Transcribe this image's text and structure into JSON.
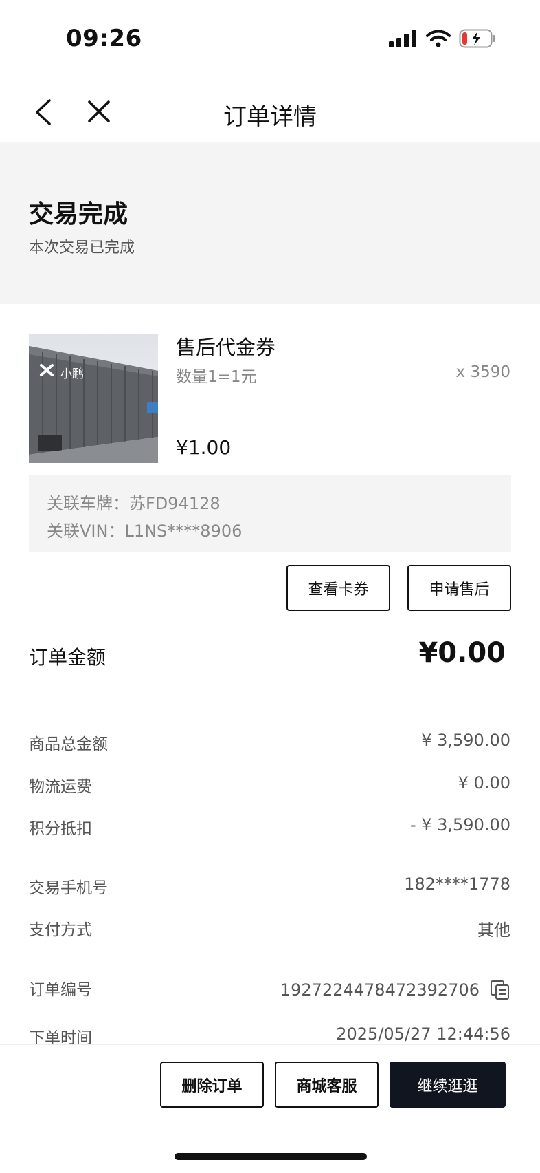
{
  "status_bar": {
    "time": "09:26"
  },
  "nav": {
    "title": "订单详情"
  },
  "order_status": {
    "heading": "交易完成",
    "description": "本次交易已完成"
  },
  "product": {
    "name": "售后代金券",
    "quantity_desc": "数量1=1元",
    "count": "x 3590",
    "price": "¥1.00",
    "thumbnail_logo": "小鹏",
    "plate": "关联车牌：苏FD94128",
    "vin": "关联VIN：L1NS****8906"
  },
  "actions": {
    "view_coupon": "查看卡券",
    "after_sale": "申请售后"
  },
  "order_amount": {
    "label": "订单金额",
    "value": "¥0.00"
  },
  "details": [
    {
      "label": "商品总金额",
      "value": "¥ 3,590.00"
    },
    {
      "label": "物流运费",
      "value": "¥ 0.00"
    },
    {
      "label": "积分抵扣",
      "value": "- ¥ 3,590.00"
    },
    {
      "label": "交易手机号",
      "value": "182****1778"
    },
    {
      "label": "支付方式",
      "value": "其他"
    },
    {
      "label": "订单编号",
      "value": "1927224478472392706"
    },
    {
      "label": "下单时间",
      "value": "2025/05/27 12:44:56"
    }
  ],
  "bottom": {
    "delete": "删除订单",
    "service": "商城客服",
    "continue": "继续逛逛"
  },
  "colors": {
    "primary_dark": "#111520",
    "panel_bg": "#f4f4f4",
    "muted_text": "#888888"
  }
}
